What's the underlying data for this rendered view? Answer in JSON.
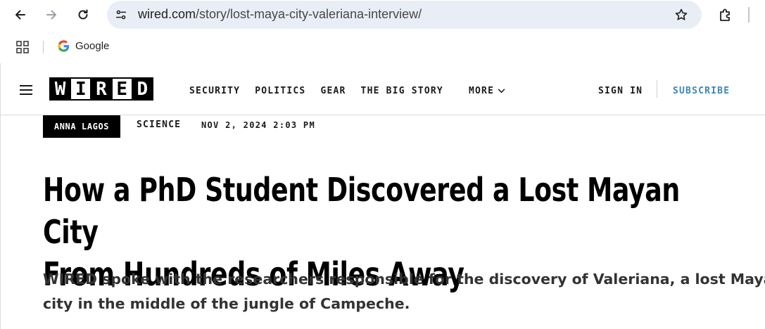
{
  "browser": {
    "url_domain": "wired.com",
    "url_path": "/story/lost-maya-city-valeriana-interview/",
    "icons": [
      "back-arrow-icon",
      "forward-arrow-icon",
      "reload-icon",
      "site-info-icon",
      "bookmark-star-icon",
      "extensions-icon"
    ]
  },
  "bookmarks": {
    "items": [
      {
        "label": "Google",
        "icon": "google-icon"
      }
    ]
  },
  "site": {
    "logo_letters": [
      "W",
      "I",
      "R",
      "E",
      "D"
    ],
    "nav": [
      "SECURITY",
      "POLITICS",
      "GEAR",
      "THE BIG STORY"
    ],
    "more_label": "MORE",
    "signin_label": "SIGN IN",
    "subscribe_label": "SUBSCRIBE",
    "accent_color": "#3d85b8"
  },
  "article": {
    "author": "ANNA LAGOS",
    "section": "SCIENCE",
    "date": "NOV 2, 2024 2:03 PM",
    "headline_line1": "How a PhD Student Discovered a Lost Mayan City",
    "headline_line2": "From Hundreds of Miles Away",
    "dek_line1": "WIRED spoke with the researchers responsible for the discovery of Valeriana, a lost Maya",
    "dek_line2": "city in the middle of the jungle of Campeche."
  }
}
